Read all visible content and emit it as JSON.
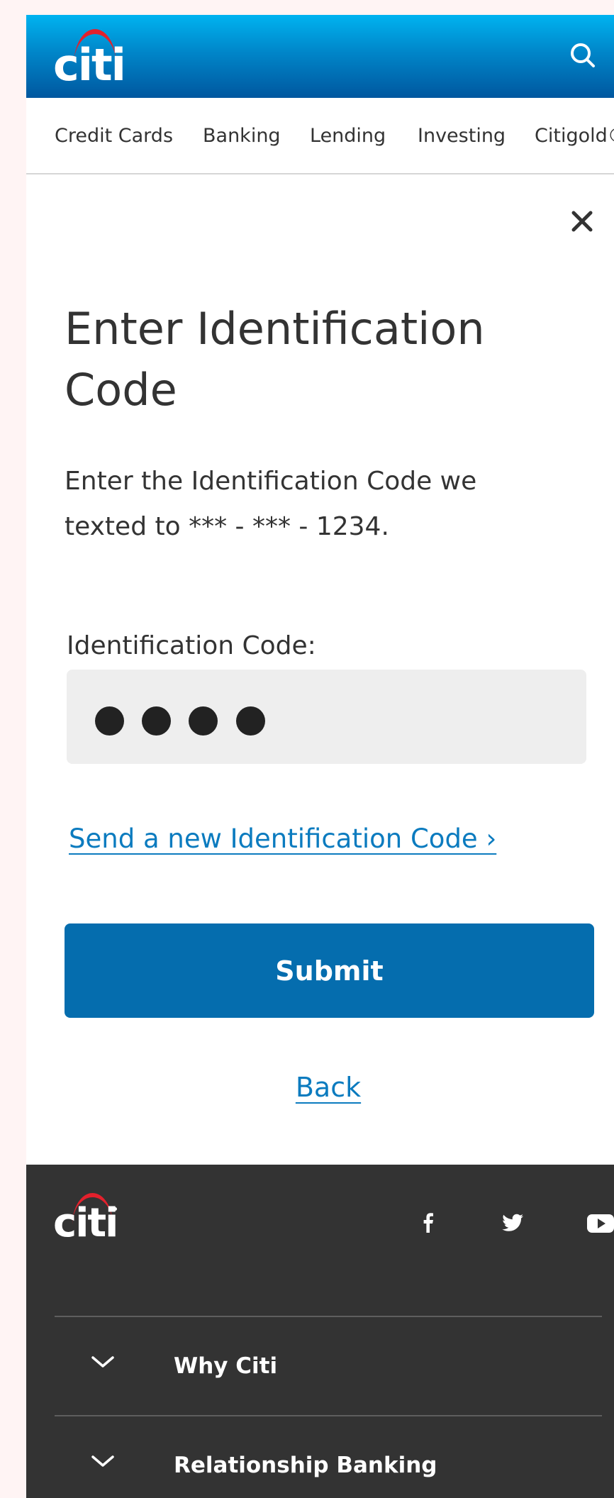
{
  "header": {
    "logo_text": "citi"
  },
  "nav": {
    "items": [
      {
        "label": "Credit Cards"
      },
      {
        "label": "Banking"
      },
      {
        "label": "Lending"
      },
      {
        "label": "Investing"
      },
      {
        "label": "Citigold®"
      }
    ]
  },
  "form": {
    "title": "Enter Identification Code",
    "instructions": "Enter the Identification Code we texted to *** - *** - 1234.",
    "field_label": "Identification Code:",
    "code_masked_length": 4,
    "resend_link": "Send a new Identification Code ›",
    "submit_label": "Submit",
    "back_label": "Back"
  },
  "footer": {
    "logo_text": "citi",
    "social": [
      "facebook-icon",
      "twitter-icon",
      "youtube-icon"
    ],
    "accordion": [
      {
        "label": "Why Citi"
      },
      {
        "label": "Relationship Banking"
      }
    ]
  },
  "colors": {
    "header_top": "#00b3f0",
    "header_bottom": "#00579f",
    "accent_blue": "#056dae",
    "link_blue": "#0b7bbf",
    "logo_arc_red": "#e3202c",
    "footer_bg": "#333333"
  }
}
